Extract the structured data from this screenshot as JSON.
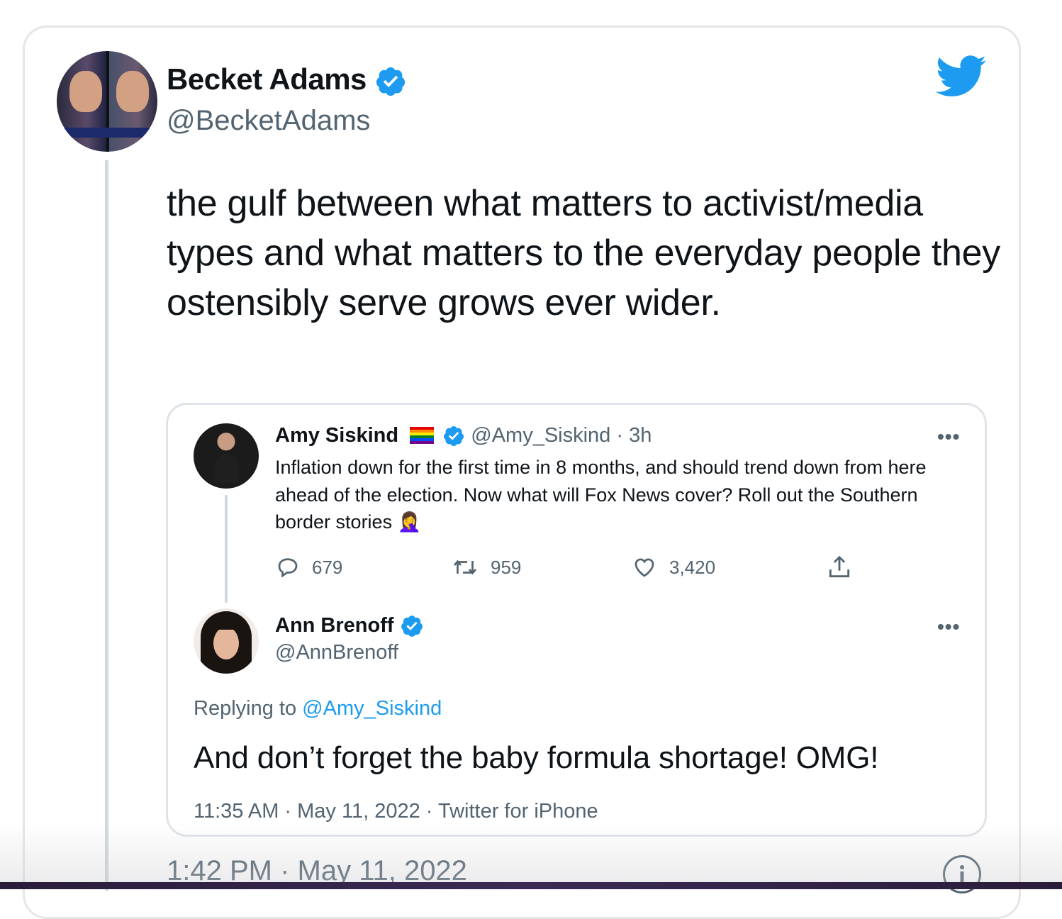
{
  "main_tweet": {
    "author_name": "Becket Adams",
    "handle": "@BecketAdams",
    "text": "the gulf between what matters to activist/media types and what matters to the everyday people they ostensibly serve grows ever wider.",
    "timestamp": "1:42 PM · May 11, 2022"
  },
  "quoted_tweet": {
    "parent": {
      "author_name": "Amy Siskind",
      "handle": "@Amy_Siskind",
      "age": "· 3h",
      "text": "Inflation down for the first time in 8 months, and should trend down from here ahead of the election. Now what will Fox News cover? Roll out the Southern border stories 🤦‍♀️",
      "replies": "679",
      "retweets": "959",
      "likes": "3,420"
    },
    "reply": {
      "author_name": "Ann Brenoff",
      "handle": "@AnnBrenoff",
      "replying_label": "Replying to ",
      "replying_mention": "@Amy_Siskind",
      "text": "And don’t forget the baby formula shortage! OMG!",
      "meta": "11:35 AM · May 11, 2022 · Twitter for iPhone"
    }
  },
  "icons": {
    "brand": "twitter-bird-icon",
    "verified": "verified-badge-icon",
    "more": "more-options-icon",
    "reply": "reply-icon",
    "retweet": "retweet-icon",
    "like": "like-icon",
    "share": "share-icon",
    "info": "info-icon"
  },
  "colors": {
    "twitter_blue": "#1d9bf0",
    "text_primary": "#0f1419",
    "text_secondary": "#536471",
    "border": "#e6e6e6"
  },
  "more_glyph": "•••"
}
